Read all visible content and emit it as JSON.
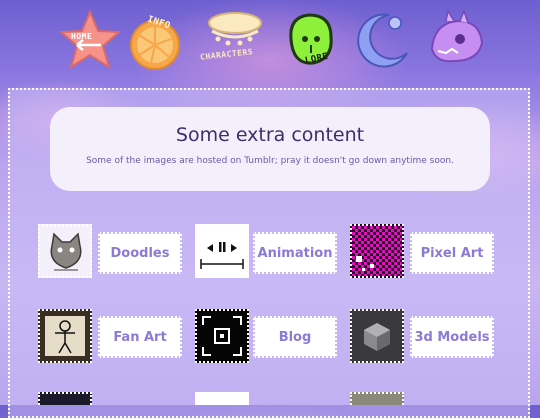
{
  "nav": {
    "home_label": "HOME",
    "info_label": "INFO",
    "characters_label": "CHARACTERS",
    "lore_label": "LORE"
  },
  "intro": {
    "title": "Some extra content",
    "subtitle": "Some of the images are hosted on Tumblr; pray it doesn't go down anytime soon."
  },
  "links": [
    {
      "label": "Doodles",
      "icon": "cat-icon"
    },
    {
      "label": "Animation",
      "icon": "playback-icon"
    },
    {
      "label": "Pixel Art",
      "icon": "pixel-pattern-icon"
    },
    {
      "label": "Fan Art",
      "icon": "stick-figure-icon"
    },
    {
      "label": "Blog",
      "icon": "camera-frame-icon"
    },
    {
      "label": "3d Models",
      "icon": "cube-icon"
    }
  ],
  "colors": {
    "accent": "#8b7ad6",
    "title": "#3b2f6a",
    "panel_border": "#ffffff"
  }
}
